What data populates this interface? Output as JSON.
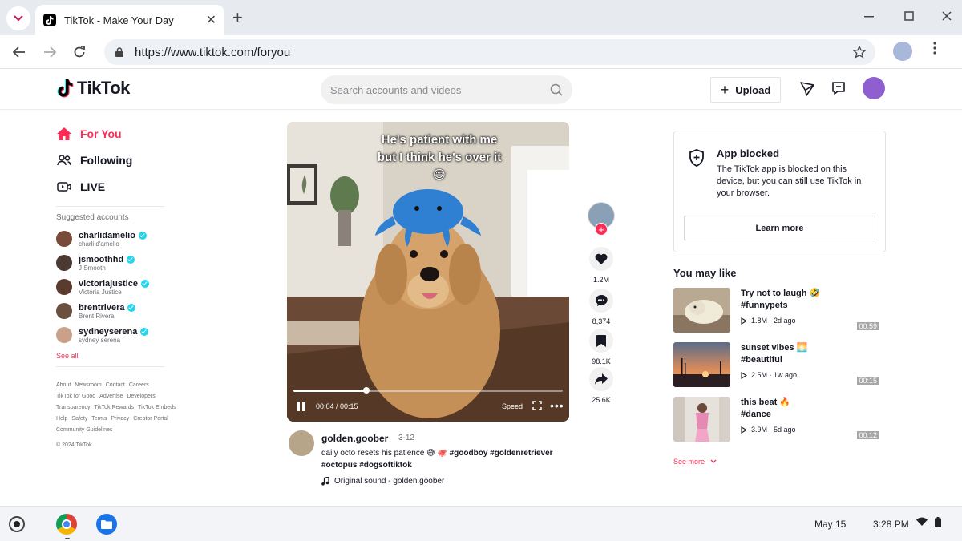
{
  "browser": {
    "tab_title": "TikTok - Make Your Day",
    "url": "https://www.tiktok.com/foryou"
  },
  "header": {
    "logo_text": "TikTok",
    "search_placeholder": "Search accounts and videos",
    "upload_label": "Upload"
  },
  "sidebar": {
    "nav": [
      {
        "label": "For You",
        "icon": "home-icon",
        "active": true
      },
      {
        "label": "Following",
        "icon": "people-icon"
      },
      {
        "label": "LIVE",
        "icon": "live-icon"
      }
    ],
    "suggested_title": "Suggested accounts",
    "accounts": [
      {
        "username": "charlidamelio",
        "name": "charli d'amelio",
        "color": "#7a4a3a"
      },
      {
        "username": "jsmoothhd",
        "name": "J Smooth",
        "color": "#4a3a32"
      },
      {
        "username": "victoriajustice",
        "name": "Victoria Justice",
        "color": "#5b3b2e"
      },
      {
        "username": "brentrivera",
        "name": "Brent Rivera",
        "color": "#6b5040"
      },
      {
        "username": "sydneyserena",
        "name": "sydney serena",
        "color": "#c9a08a"
      }
    ],
    "see_all": "See all",
    "footer_links": [
      [
        "About",
        "Newsroom",
        "Contact",
        "Careers"
      ],
      [
        "TikTok for Good",
        "Advertise",
        "Developers"
      ],
      [
        "Transparency",
        "TikTok Rewards",
        "TikTok Embeds"
      ],
      [
        "Help",
        "Safety",
        "Terms",
        "Privacy",
        "Creator Portal"
      ],
      [
        "Community Guidelines"
      ]
    ],
    "copyright": "© 2024 TikTok"
  },
  "video": {
    "caption": "He's patient with me but I think he's over it 😅",
    "time": "00:04 / 00:15",
    "progress": 0.27,
    "speed_label": "Speed"
  },
  "actions": {
    "likes": "1.2M",
    "comments": "8,374",
    "saves": "98.1K",
    "shares": "25.6K"
  },
  "post": {
    "username": "golden.goober",
    "date": "3-12",
    "description": "daily octo resets his patience 😅 🐙",
    "hashtags_line1": "#goodboy #goldenretriever",
    "hashtags_line2": "#octopus #dogsoftiktok",
    "sound": "Original sound - golden.goober"
  },
  "blocked": {
    "title": "App blocked",
    "body": "The TikTok app is blocked on this device, but you can still use TikTok in your browser.",
    "button": "Learn more"
  },
  "may_like": {
    "title": "You may like",
    "items": [
      {
        "title": "Try not to laugh 🤣",
        "tag": "#funnypets",
        "duration": "00:59",
        "views": "1.8M",
        "ago": "2d ago"
      },
      {
        "title": "sunset vibes 🌅",
        "tag": "#beautiful",
        "duration": "00:15",
        "views": "2.5M",
        "ago": "1w ago"
      },
      {
        "title": "this beat 🔥",
        "tag": "#dance",
        "duration": "00:12",
        "views": "3.9M",
        "ago": "5d ago"
      }
    ],
    "see_more": "See more"
  },
  "shelf": {
    "date": "May 15",
    "time": "3:28 PM"
  },
  "colors": {
    "accent": "#fe2c55",
    "verified": "#20d5ec"
  }
}
